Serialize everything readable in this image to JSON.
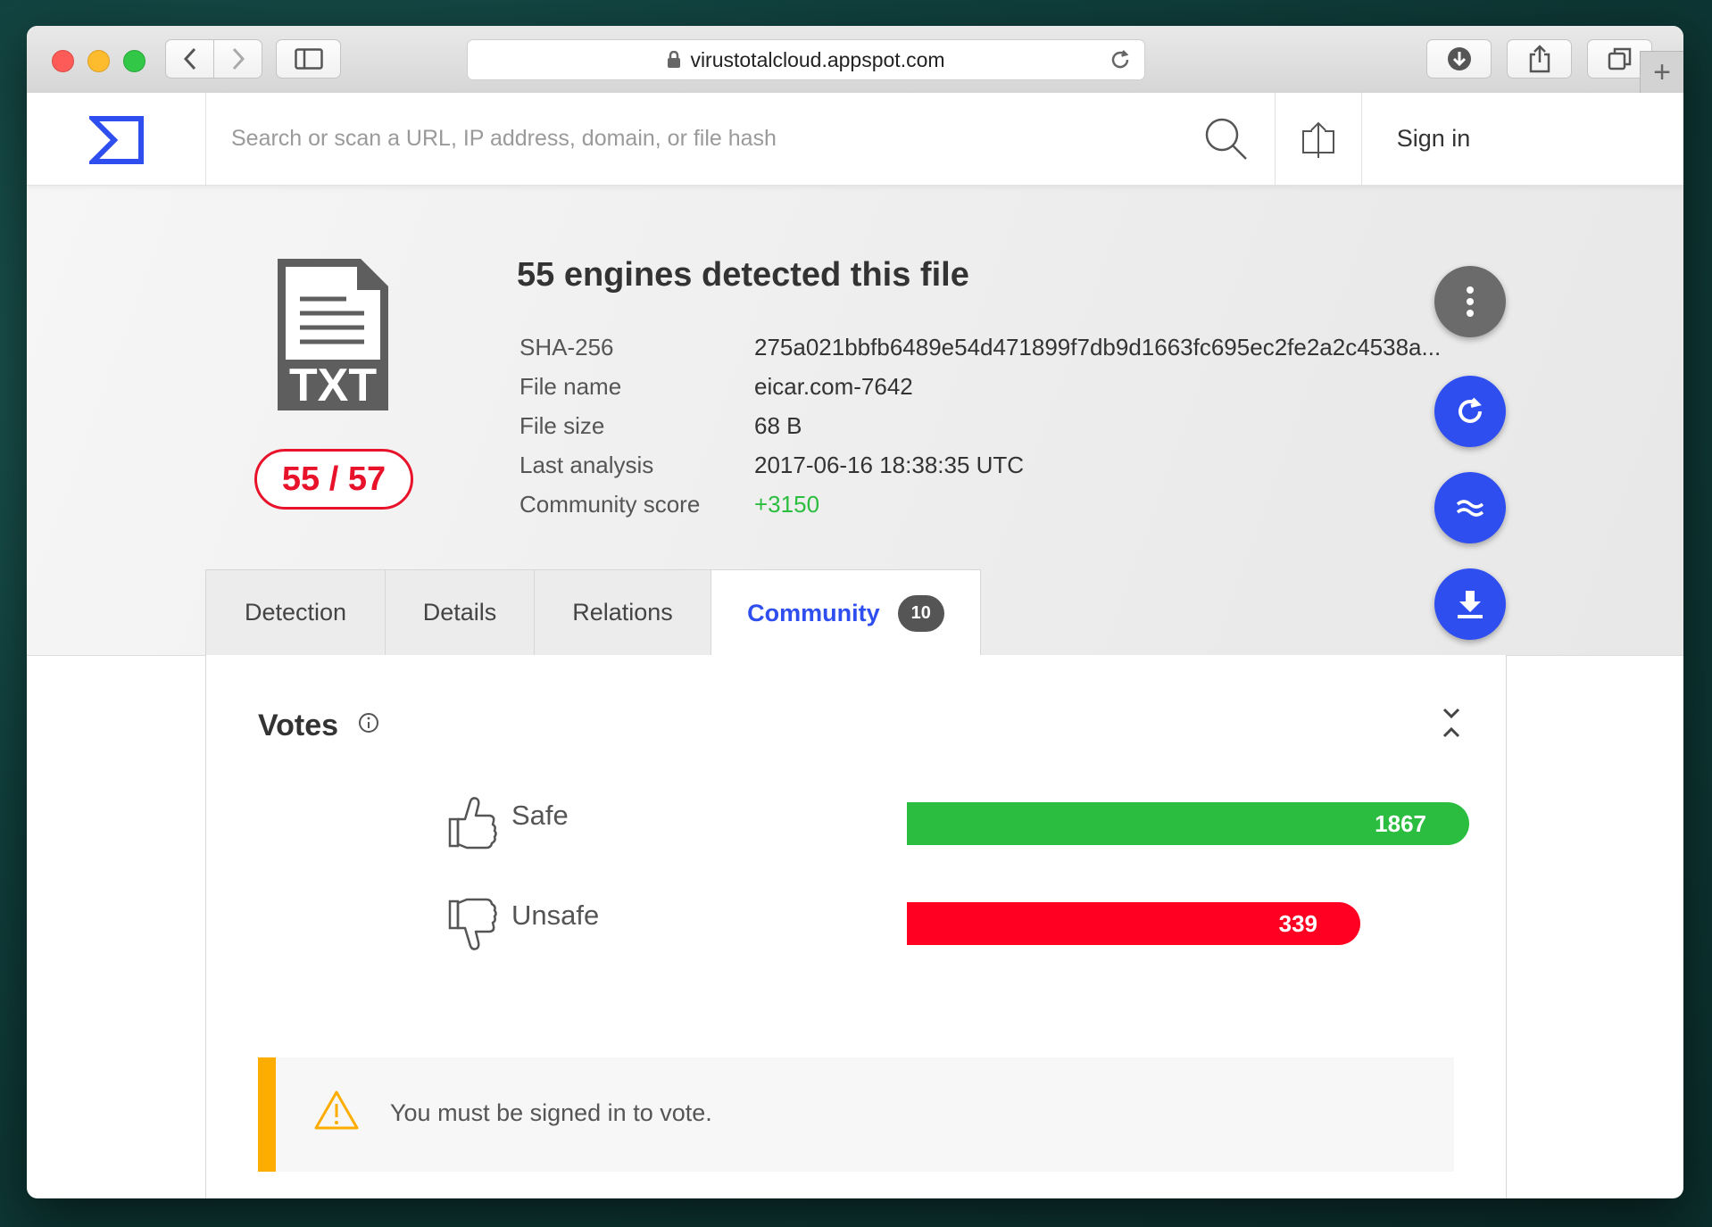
{
  "browser": {
    "url": "virustotalcloud.appspot.com"
  },
  "header": {
    "search_placeholder": "Search or scan a URL, IP address, domain, or file hash",
    "sign_in": "Sign in"
  },
  "summary": {
    "file_type": "TXT",
    "ratio": "55 / 57",
    "headline": "55 engines detected this file",
    "meta": [
      {
        "key": "SHA-256",
        "value": "275a021bbfb6489e54d471899f7db9d1663fc695ec2fe2a2c4538a..."
      },
      {
        "key": "File name",
        "value": "eicar.com-7642"
      },
      {
        "key": "File size",
        "value": "68 B"
      },
      {
        "key": "Last analysis",
        "value": "2017-06-16 18:38:35 UTC"
      },
      {
        "key": "Community score",
        "value": "+3150"
      }
    ]
  },
  "tabs": [
    {
      "label": "Detection"
    },
    {
      "label": "Details"
    },
    {
      "label": "Relations"
    },
    {
      "label": "Community",
      "badge": "10",
      "active": true
    }
  ],
  "votes": {
    "title": "Votes",
    "safe": {
      "label": "Safe",
      "count": "1867",
      "color": "#2bbd3f"
    },
    "unsafe": {
      "label": "Unsafe",
      "count": "339",
      "color": "#ff0022"
    }
  },
  "notice": {
    "text": "You must be signed in to vote."
  },
  "colors": {
    "accent": "#2f4ef0",
    "danger": "#e8132a",
    "positive": "#2bbd3f",
    "warning": "#fdac00"
  },
  "icons": [
    "back-icon",
    "forward-icon",
    "sidebar-icon",
    "lock-icon",
    "reload-icon",
    "download-icon",
    "share-icon",
    "tabs-icon",
    "virustotal-logo",
    "search-icon",
    "upload-icon",
    "txt-file-icon",
    "more-icon",
    "reanalyze-icon",
    "similar-icon",
    "download-file-icon",
    "info-icon",
    "collapse-icon",
    "thumbs-up-icon",
    "thumbs-down-icon",
    "warning-icon"
  ]
}
